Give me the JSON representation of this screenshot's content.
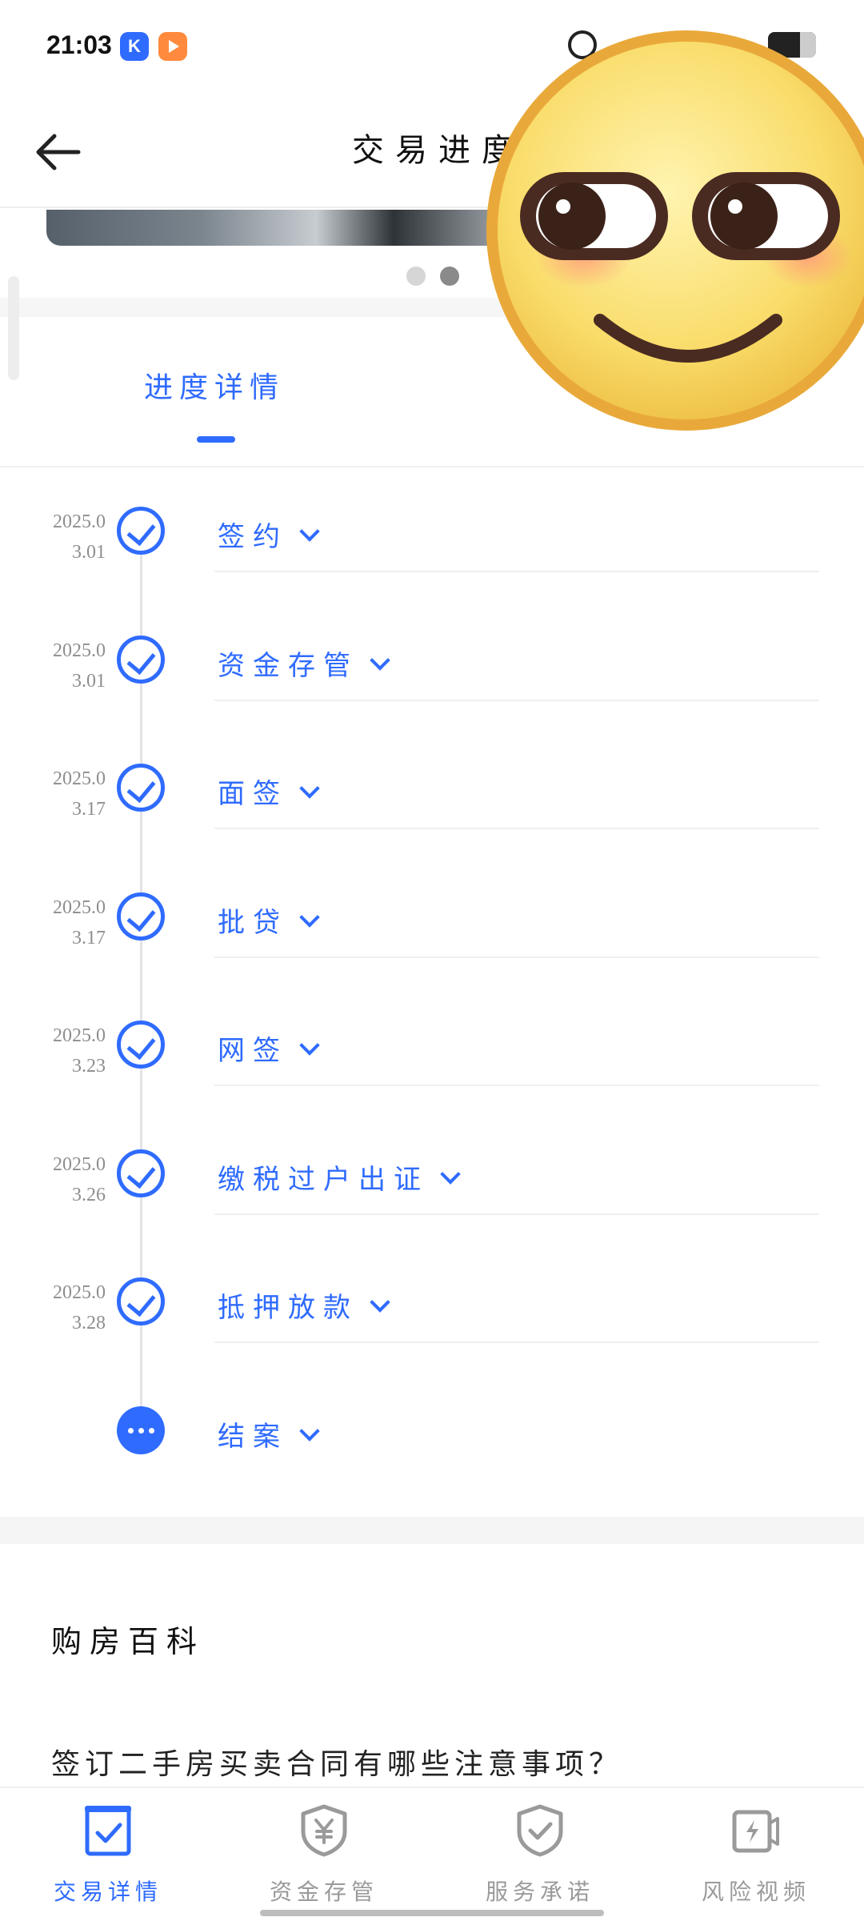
{
  "status_bar": {
    "time": "21:03",
    "app1_glyph": "K"
  },
  "header": {
    "title": "交易进度",
    "back_icon": "arrow-left-icon"
  },
  "tabs": {
    "progress_label": "进度详情"
  },
  "timeline": {
    "accent_color": "#2f6bff",
    "steps": [
      {
        "date_line1": "2025.0",
        "date_line2": "3.01",
        "label": "签约",
        "done": true
      },
      {
        "date_line1": "2025.0",
        "date_line2": "3.01",
        "label": "资金存管",
        "done": true
      },
      {
        "date_line1": "2025.0",
        "date_line2": "3.17",
        "label": "面签",
        "done": true
      },
      {
        "date_line1": "2025.0",
        "date_line2": "3.17",
        "label": "批贷",
        "done": true
      },
      {
        "date_line1": "2025.0",
        "date_line2": "3.23",
        "label": "网签",
        "done": true
      },
      {
        "date_line1": "2025.0",
        "date_line2": "3.26",
        "label": "缴税过户出证",
        "done": true
      },
      {
        "date_line1": "2025.0",
        "date_line2": "3.28",
        "label": "抵押放款",
        "done": true
      },
      {
        "date_line1": "",
        "date_line2": "",
        "label": "结案",
        "done": false
      }
    ]
  },
  "guide": {
    "title": "购房百科",
    "article": "签订二手房买卖合同有哪些注意事项？"
  },
  "bottom_nav": [
    {
      "label": "交易详情",
      "icon": "clipboard-check-icon",
      "active": true
    },
    {
      "label": "资金存管",
      "icon": "yen-shield-icon",
      "active": false
    },
    {
      "label": "服务承诺",
      "icon": "check-shield-icon",
      "active": false
    },
    {
      "label": "风险视频",
      "icon": "video-bolt-icon",
      "active": false
    }
  ]
}
